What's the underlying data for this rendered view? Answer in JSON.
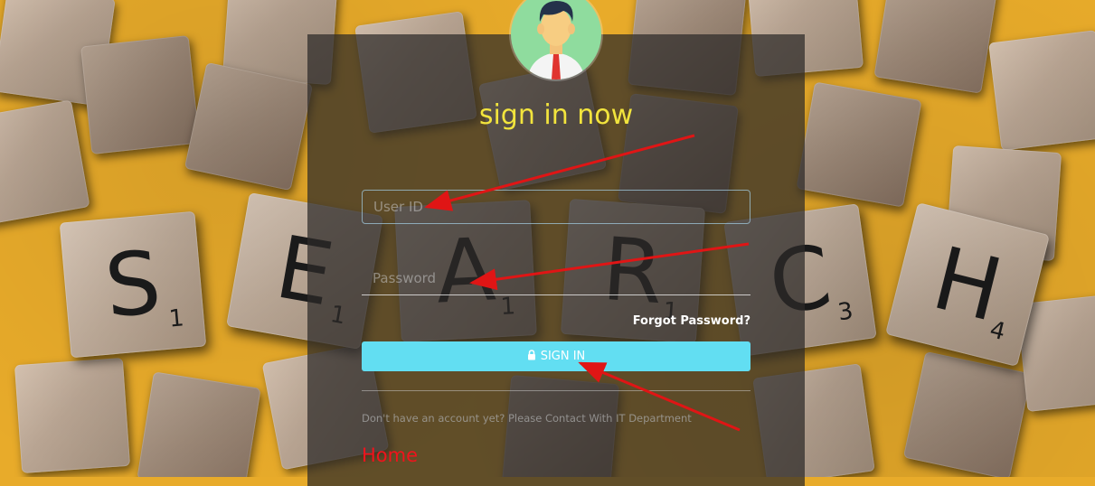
{
  "login": {
    "title": "sign in now",
    "user_id_placeholder": "User ID",
    "password_placeholder": "Password",
    "forgot_password": "Forgot Password?",
    "sign_in_label": "SIGN IN",
    "note": "Don't have an account yet?  Please Contact With IT Department",
    "home_link": "Home"
  },
  "background": {
    "letters": [
      {
        "char": "S",
        "sub": "1"
      },
      {
        "char": "E",
        "sub": "1"
      },
      {
        "char": "A",
        "sub": "1"
      },
      {
        "char": "R",
        "sub": "1"
      },
      {
        "char": "C",
        "sub": "3"
      },
      {
        "char": "H",
        "sub": "4"
      }
    ]
  },
  "colors": {
    "title": "#f2e43d",
    "button": "#62def2",
    "home_link": "#f0131c",
    "annotation_arrow": "#e01515",
    "avatar_bg": "#8fdc9e"
  },
  "icons": {
    "button_icon": "lock-icon",
    "avatar": "user-avatar-icon"
  }
}
